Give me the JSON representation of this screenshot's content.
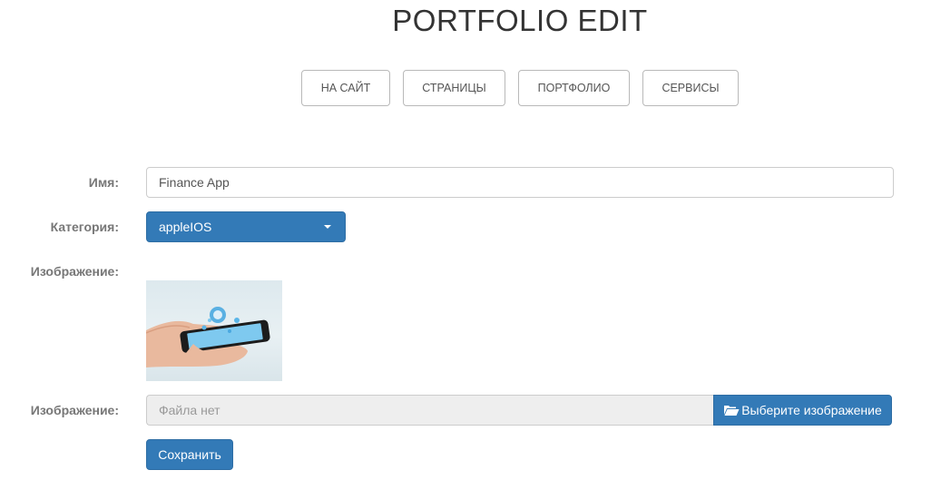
{
  "page": {
    "title": "PORTFOLIO EDIT"
  },
  "nav": [
    {
      "label": "НА САЙТ"
    },
    {
      "label": "СТРАНИЦЫ"
    },
    {
      "label": "ПОРТФОЛИО"
    },
    {
      "label": "СЕРВИСЫ"
    }
  ],
  "form": {
    "name_label": "Имя:",
    "name_value": "Finance App",
    "category_label": "Категория:",
    "category_value": "appleIOS",
    "image_label": "Изображение:",
    "file_label": "Изображение:",
    "file_placeholder": "Файла нет",
    "file_button": "Выберите изображение",
    "save_button": "Сохранить"
  },
  "colors": {
    "primary": "#337ab7",
    "primary_border": "#2e6da4",
    "label": "#777777"
  },
  "icons": {
    "file_button_icon": "folder-open-icon",
    "select_caret": "caret-down-icon"
  }
}
